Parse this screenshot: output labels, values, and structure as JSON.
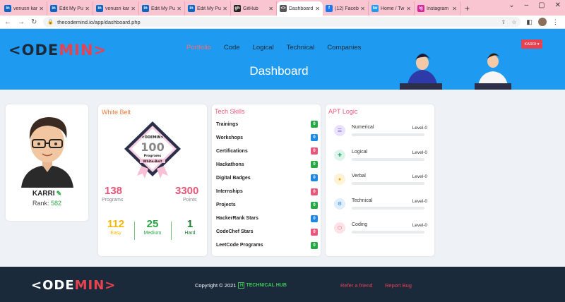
{
  "browser": {
    "tabs": [
      {
        "label": "venusri kar",
        "icon": "in",
        "color": "#0a66c2"
      },
      {
        "label": "Edit My Pu",
        "icon": "in",
        "color": "#0a66c2"
      },
      {
        "label": "venusri kar",
        "icon": "in",
        "color": "#0a66c2"
      },
      {
        "label": "Edit My Pu",
        "icon": "in",
        "color": "#0a66c2"
      },
      {
        "label": "Edit My Pu",
        "icon": "in",
        "color": "#0a66c2"
      },
      {
        "label": "GitHub",
        "icon": "gh",
        "color": "#222222"
      },
      {
        "label": "Dashboard",
        "icon": "<>",
        "color": "#555555",
        "active": true
      },
      {
        "label": "(12) Facebo",
        "icon": "f",
        "color": "#1877f2"
      },
      {
        "label": "Home / Tw",
        "icon": "tw",
        "color": "#1d9bf0"
      },
      {
        "label": "Instagram",
        "icon": "ig",
        "color": "#d6249f"
      }
    ],
    "url": "thecodemind.io/app/dashboard.php"
  },
  "header": {
    "logo_prefix": "<ODE",
    "logo_suffix": "MIN>",
    "nav": [
      "Portfolio",
      "Code",
      "Logical",
      "Technical",
      "Companies"
    ],
    "title": "Dashboard",
    "user_button": "KARRI ▾"
  },
  "profile": {
    "name": "KARRI",
    "rank_label": "Rank:",
    "rank_value": "582"
  },
  "belt": {
    "title": "White Belt",
    "badge_brand": "<ODEMIN>",
    "badge_number": "100",
    "badge_line1": "Programs",
    "badge_line2": "White-Belt",
    "programs_value": "138",
    "programs_label": "Programs",
    "points_value": "3300",
    "points_label": "Points",
    "easy_value": "112",
    "easy_label": "Easy",
    "medium_value": "25",
    "medium_label": "Medium",
    "hard_value": "1",
    "hard_label": "Hard",
    "colors": {
      "easy": "#f5b800",
      "medium": "#28a745",
      "hard": "#1e7b34"
    }
  },
  "tech": {
    "title": "Tech Skills",
    "rows": [
      {
        "label": "Trainings",
        "count": "0",
        "color": "#28a745"
      },
      {
        "label": "Workshops",
        "count": "0",
        "color": "#1e88e5"
      },
      {
        "label": "Certifications",
        "count": "0",
        "color": "#e8577a"
      },
      {
        "label": "Hackathons",
        "count": "0",
        "color": "#28a745"
      },
      {
        "label": "Digital Badges",
        "count": "0",
        "color": "#1e88e5"
      },
      {
        "label": "Internships",
        "count": "0",
        "color": "#e8577a"
      },
      {
        "label": "Projects",
        "count": "0",
        "color": "#28a745"
      },
      {
        "label": "HackerRank Stars",
        "count": "0",
        "color": "#1e88e5"
      },
      {
        "label": "CodeChef Stars",
        "count": "0",
        "color": "#e8577a"
      },
      {
        "label": "LeetCode Programs",
        "count": "0",
        "color": "#28a745"
      }
    ]
  },
  "apt": {
    "title": "APT Logic",
    "rows": [
      {
        "label": "Numerical",
        "level": "Level-0",
        "icon": "list-icon",
        "bg": "#e9e3ff",
        "fg": "#7a5cf0"
      },
      {
        "label": "Logical",
        "level": "Level-0",
        "icon": "puzzle-icon",
        "bg": "#dff5ec",
        "fg": "#24a56c"
      },
      {
        "label": "Verbal",
        "level": "Level-0",
        "icon": "chat-icon",
        "bg": "#fff3d6",
        "fg": "#e7a51c"
      },
      {
        "label": "Technical",
        "level": "Level-0",
        "icon": "gears-icon",
        "bg": "#dfeeff",
        "fg": "#2e7fe0"
      },
      {
        "label": "Coding",
        "level": "Level-0",
        "icon": "cube-icon",
        "bg": "#ffe2e5",
        "fg": "#e8577a"
      }
    ]
  },
  "footer": {
    "logo_prefix": "<ODE",
    "logo_suffix": "MIN>",
    "copyright": "Copyright © 2021",
    "brand": "TECHNICAL HUB",
    "brand_initial": "H",
    "link1": "Refer a friend",
    "link2": "Report Bug"
  }
}
